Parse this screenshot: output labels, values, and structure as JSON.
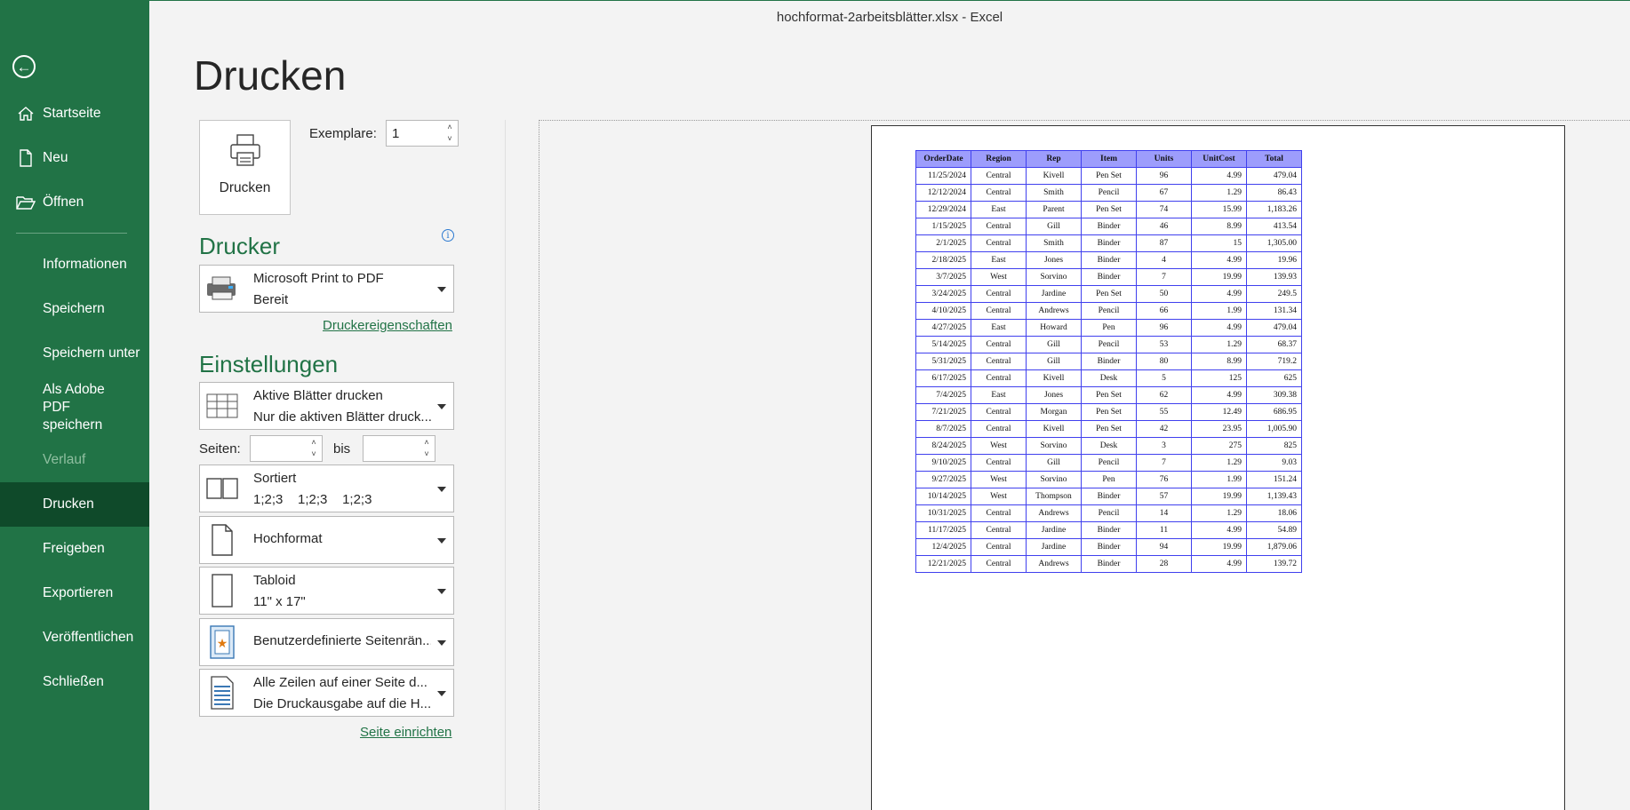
{
  "window": {
    "title": "hochformat-2arbeitsblätter.xlsx  -  Excel"
  },
  "sidebar": {
    "items": [
      {
        "label": "Startseite",
        "icon": "home-icon"
      },
      {
        "label": "Neu",
        "icon": "new-document-icon"
      },
      {
        "label": "Öffnen",
        "icon": "open-folder-icon"
      },
      {
        "label": "Informationen"
      },
      {
        "label": "Speichern"
      },
      {
        "label": "Speichern unter"
      },
      {
        "label": "Als Adobe PDF speichern"
      },
      {
        "label": "Verlauf",
        "disabled": true
      },
      {
        "label": "Drucken",
        "active": true
      },
      {
        "label": "Freigeben"
      },
      {
        "label": "Exportieren"
      },
      {
        "label": "Veröffentlichen"
      },
      {
        "label": "Schließen"
      }
    ]
  },
  "print": {
    "title": "Drucken",
    "print_button_label": "Drucken",
    "copies_label": "Exemplare:",
    "copies_value": "1",
    "printer_heading": "Drucker",
    "printer": {
      "name": "Microsoft Print to PDF",
      "status": "Bereit"
    },
    "printer_properties_link": "Druckereigenschaften",
    "settings_heading": "Einstellungen",
    "settings": {
      "what": {
        "line1": "Aktive Blätter drucken",
        "line2": "Nur die aktiven Blätter druck..."
      },
      "pages_label": "Seiten:",
      "to_label": "bis",
      "collation": {
        "line1": "Sortiert",
        "line2": "1;2;3    1;2;3    1;2;3"
      },
      "orientation": {
        "line1": "Hochformat"
      },
      "paper": {
        "line1": "Tabloid",
        "line2": "11\" x 17\""
      },
      "margins": {
        "line1": "Benutzerdefinierte Seitenrän..."
      },
      "scaling": {
        "line1": "Alle Zeilen auf einer Seite d...",
        "line2": "Die Druckausgabe auf die H..."
      }
    },
    "page_setup_link": "Seite einrichten"
  },
  "preview": {
    "columns": [
      "OrderDate",
      "Region",
      "Rep",
      "Item",
      "Units",
      "UnitCost",
      "Total"
    ],
    "rows": [
      [
        "11/25/2024",
        "Central",
        "Kivell",
        "Pen Set",
        "96",
        "4.99",
        "479.04"
      ],
      [
        "12/12/2024",
        "Central",
        "Smith",
        "Pencil",
        "67",
        "1.29",
        "86.43"
      ],
      [
        "12/29/2024",
        "East",
        "Parent",
        "Pen Set",
        "74",
        "15.99",
        "1,183.26"
      ],
      [
        "1/15/2025",
        "Central",
        "Gill",
        "Binder",
        "46",
        "8.99",
        "413.54"
      ],
      [
        "2/1/2025",
        "Central",
        "Smith",
        "Binder",
        "87",
        "15",
        "1,305.00"
      ],
      [
        "2/18/2025",
        "East",
        "Jones",
        "Binder",
        "4",
        "4.99",
        "19.96"
      ],
      [
        "3/7/2025",
        "West",
        "Sorvino",
        "Binder",
        "7",
        "19.99",
        "139.93"
      ],
      [
        "3/24/2025",
        "Central",
        "Jardine",
        "Pen Set",
        "50",
        "4.99",
        "249.5"
      ],
      [
        "4/10/2025",
        "Central",
        "Andrews",
        "Pencil",
        "66",
        "1.99",
        "131.34"
      ],
      [
        "4/27/2025",
        "East",
        "Howard",
        "Pen",
        "96",
        "4.99",
        "479.04"
      ],
      [
        "5/14/2025",
        "Central",
        "Gill",
        "Pencil",
        "53",
        "1.29",
        "68.37"
      ],
      [
        "5/31/2025",
        "Central",
        "Gill",
        "Binder",
        "80",
        "8.99",
        "719.2"
      ],
      [
        "6/17/2025",
        "Central",
        "Kivell",
        "Desk",
        "5",
        "125",
        "625"
      ],
      [
        "7/4/2025",
        "East",
        "Jones",
        "Pen Set",
        "62",
        "4.99",
        "309.38"
      ],
      [
        "7/21/2025",
        "Central",
        "Morgan",
        "Pen Set",
        "55",
        "12.49",
        "686.95"
      ],
      [
        "8/7/2025",
        "Central",
        "Kivell",
        "Pen Set",
        "42",
        "23.95",
        "1,005.90"
      ],
      [
        "8/24/2025",
        "West",
        "Sorvino",
        "Desk",
        "3",
        "275",
        "825"
      ],
      [
        "9/10/2025",
        "Central",
        "Gill",
        "Pencil",
        "7",
        "1.29",
        "9.03"
      ],
      [
        "9/27/2025",
        "West",
        "Sorvino",
        "Pen",
        "76",
        "1.99",
        "151.24"
      ],
      [
        "10/14/2025",
        "West",
        "Thompson",
        "Binder",
        "57",
        "19.99",
        "1,139.43"
      ],
      [
        "10/31/2025",
        "Central",
        "Andrews",
        "Pencil",
        "14",
        "1.29",
        "18.06"
      ],
      [
        "11/17/2025",
        "Central",
        "Jardine",
        "Binder",
        "11",
        "4.99",
        "54.89"
      ],
      [
        "12/4/2025",
        "Central",
        "Jardine",
        "Binder",
        "94",
        "19.99",
        "1,879.06"
      ],
      [
        "12/21/2025",
        "Central",
        "Andrews",
        "Binder",
        "28",
        "4.99",
        "139.72"
      ]
    ]
  },
  "colors": {
    "accent": "#217346",
    "sidebar_active": "#0f4a2a",
    "table_border": "#4040ee",
    "table_header": "#9d9dfc"
  }
}
